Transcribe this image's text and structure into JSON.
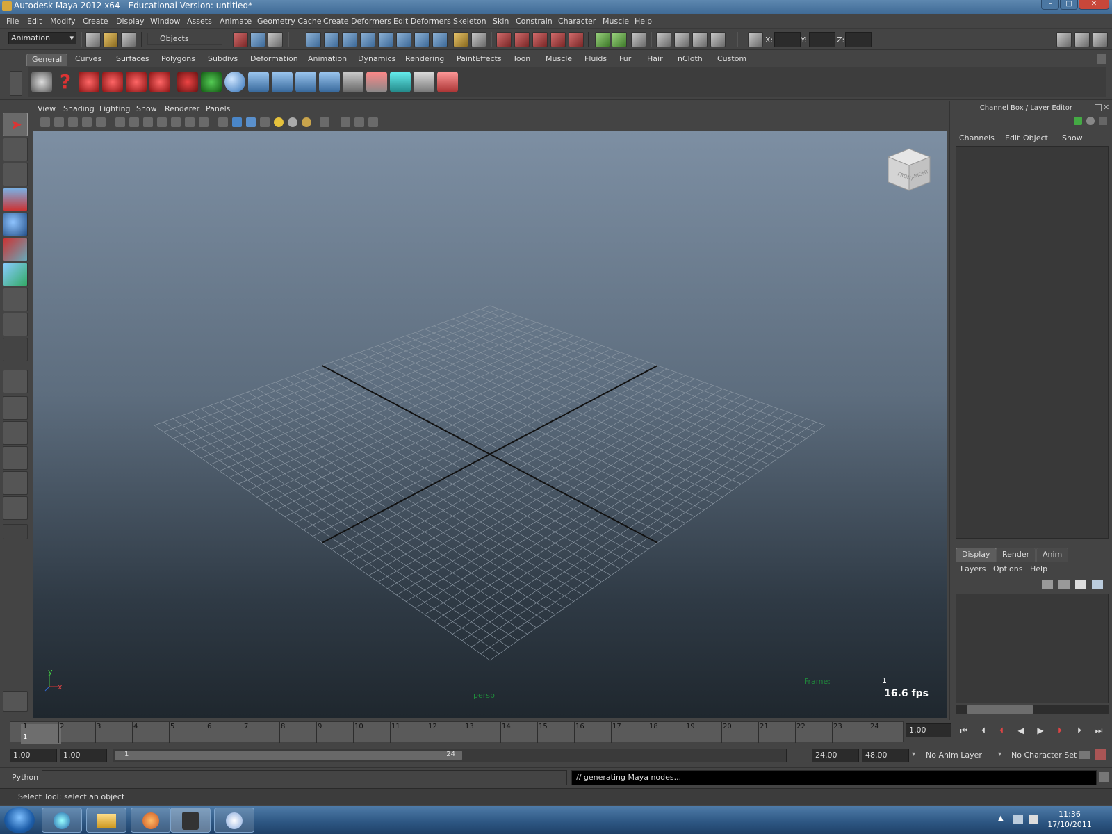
{
  "window": {
    "title": "Autodesk Maya 2012 x64 - Educational Version: untitled*"
  },
  "menu": [
    "File",
    "Edit",
    "Modify",
    "Create",
    "Display",
    "Window",
    "Assets",
    "Animate",
    "Geometry Cache",
    "Create Deformers",
    "Edit Deformers",
    "Skeleton",
    "Skin",
    "Constrain",
    "Character",
    "Muscle",
    "Help"
  ],
  "statusline": {
    "menu_set": "Animation",
    "selection_mode": "Objects",
    "x_label": "X:",
    "y_label": "Y:",
    "z_label": "Z:"
  },
  "shelf": {
    "tabs": [
      "General",
      "Curves",
      "Surfaces",
      "Polygons",
      "Subdivs",
      "Deformation",
      "Animation",
      "Dynamics",
      "Rendering",
      "PaintEffects",
      "Toon",
      "Muscle",
      "Fluids",
      "Fur",
      "Hair",
      "nCloth",
      "Custom"
    ],
    "active_tab": "General",
    "icons": [
      "scene-clapper-icon",
      "help-question-icon",
      "create-camera-icon",
      "camera-aim-icon",
      "camera-aim-up-icon",
      "camera-reel-icon",
      "magnet-red-icon",
      "curve-green-icon",
      "sphere-icon",
      "joint-1-icon",
      "joint-2-icon",
      "joint-3-icon",
      "joint-4-icon",
      "outliner-icon",
      "paint-render-icon",
      "render-cube-icon",
      "cubes-icon",
      "paint-brush-icon"
    ]
  },
  "panel": {
    "menu": [
      "View",
      "Shading",
      "Lighting",
      "Show",
      "Renderer",
      "Panels"
    ],
    "camera": "persp",
    "frame_label": "Frame:",
    "frame_value": "1",
    "fps": "16.6 fps",
    "axis_y": "y",
    "axis_x": "x",
    "viewcube_front": "FRONT",
    "viewcube_right": "RIGHT"
  },
  "channel_box": {
    "title": "Channel Box / Layer Editor",
    "menu": [
      "Channels",
      "Edit",
      "Object",
      "Show"
    ]
  },
  "layer_editor": {
    "tabs": [
      "Display",
      "Render",
      "Anim"
    ],
    "active_tab": "Display",
    "menu": [
      "Layers",
      "Options",
      "Help"
    ]
  },
  "timeline": {
    "ticks": [
      "1",
      "2",
      "3",
      "4",
      "5",
      "6",
      "7",
      "8",
      "9",
      "10",
      "11",
      "12",
      "13",
      "14",
      "15",
      "16",
      "17",
      "18",
      "19",
      "20",
      "21",
      "22",
      "23",
      "24"
    ],
    "current_frame_marker": "1",
    "current_time": "1.00"
  },
  "range": {
    "start": "1.00",
    "playback_start": "1.00",
    "slider_start": "1",
    "slider_end": "24",
    "playback_end": "24.00",
    "end": "48.00",
    "anim_layer": "No Anim Layer",
    "character_set": "No Character Set"
  },
  "command": {
    "language": "Python",
    "result": "// generating Maya nodes..."
  },
  "help_line": "Select Tool: select an object",
  "taskbar": {
    "time": "11:36",
    "date": "17/10/2011"
  },
  "colors": {
    "accent": "#5d5d5d",
    "viewport_top": "#7d8fa3",
    "viewport_bottom": "#1f272e",
    "perspective_label": "#1f8a3b"
  }
}
